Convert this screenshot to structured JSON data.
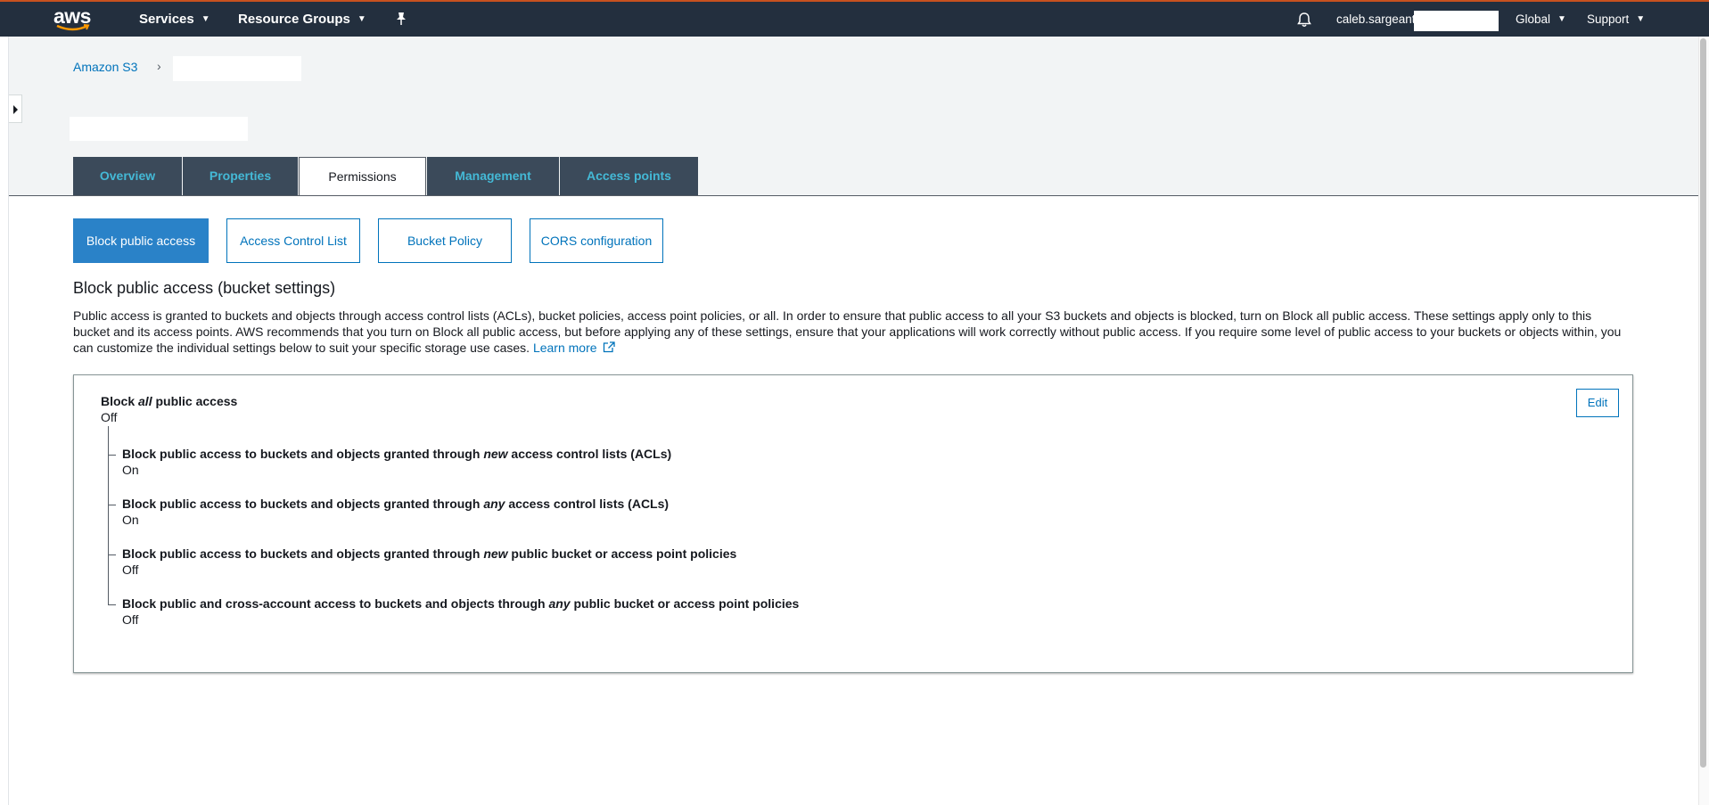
{
  "topnav": {
    "logo_text": "aws",
    "services_label": "Services",
    "resource_groups_label": "Resource Groups",
    "user_label": "caleb.sargeant",
    "region_label": "Global",
    "support_label": "Support"
  },
  "breadcrumb": {
    "root": "Amazon S3",
    "separator": "›"
  },
  "tabs": [
    {
      "label": "Overview"
    },
    {
      "label": "Properties"
    },
    {
      "label": "Permissions"
    },
    {
      "label": "Management"
    },
    {
      "label": "Access points"
    }
  ],
  "subtabs": [
    {
      "label": "Block public access"
    },
    {
      "label": "Access Control List"
    },
    {
      "label": "Bucket Policy"
    },
    {
      "label": "CORS configuration"
    }
  ],
  "section": {
    "title": "Block public access (bucket settings)",
    "description": "Public access is granted to buckets and objects through access control lists (ACLs), bucket policies, access point policies, or all. In order to ensure that public access to all your S3 buckets and objects is blocked, turn on Block all public access. These settings apply only to this bucket and its access points. AWS recommends that you turn on Block all public access, but before applying any of these settings, ensure that your applications will work correctly without public access. If you require some level of public access to your buckets or objects within, you can customize the individual settings below to suit your specific storage use cases.",
    "learn_more": "Learn more"
  },
  "panel": {
    "edit_label": "Edit",
    "all": {
      "prefix": "Block ",
      "emph": "all",
      "suffix": " public access",
      "value": "Off"
    },
    "settings": [
      {
        "prefix": "Block public access to buckets and objects granted through ",
        "emph": "new",
        "suffix": " access control lists (ACLs)",
        "value": "On"
      },
      {
        "prefix": "Block public access to buckets and objects granted through ",
        "emph": "any",
        "suffix": " access control lists (ACLs)",
        "value": "On"
      },
      {
        "prefix": "Block public access to buckets and objects granted through ",
        "emph": "new",
        "suffix": " public bucket or access point policies",
        "value": "Off"
      },
      {
        "prefix": "Block public and cross-account access to buckets and objects through ",
        "emph": "any",
        "suffix": " public bucket or access point policies",
        "value": "Off"
      }
    ]
  },
  "colors": {
    "nav_bg": "#232f3e",
    "link": "#0073bb",
    "tab_bg": "#3b4a5a",
    "tab_text": "#44b9d6",
    "active_subtab": "#2a82c8"
  },
  "icons": {
    "pin": "pin-icon",
    "bell": "bell-icon",
    "external": "external-link-icon",
    "chevron": "chevron-down-icon",
    "sidebar": "caret-right-icon"
  }
}
